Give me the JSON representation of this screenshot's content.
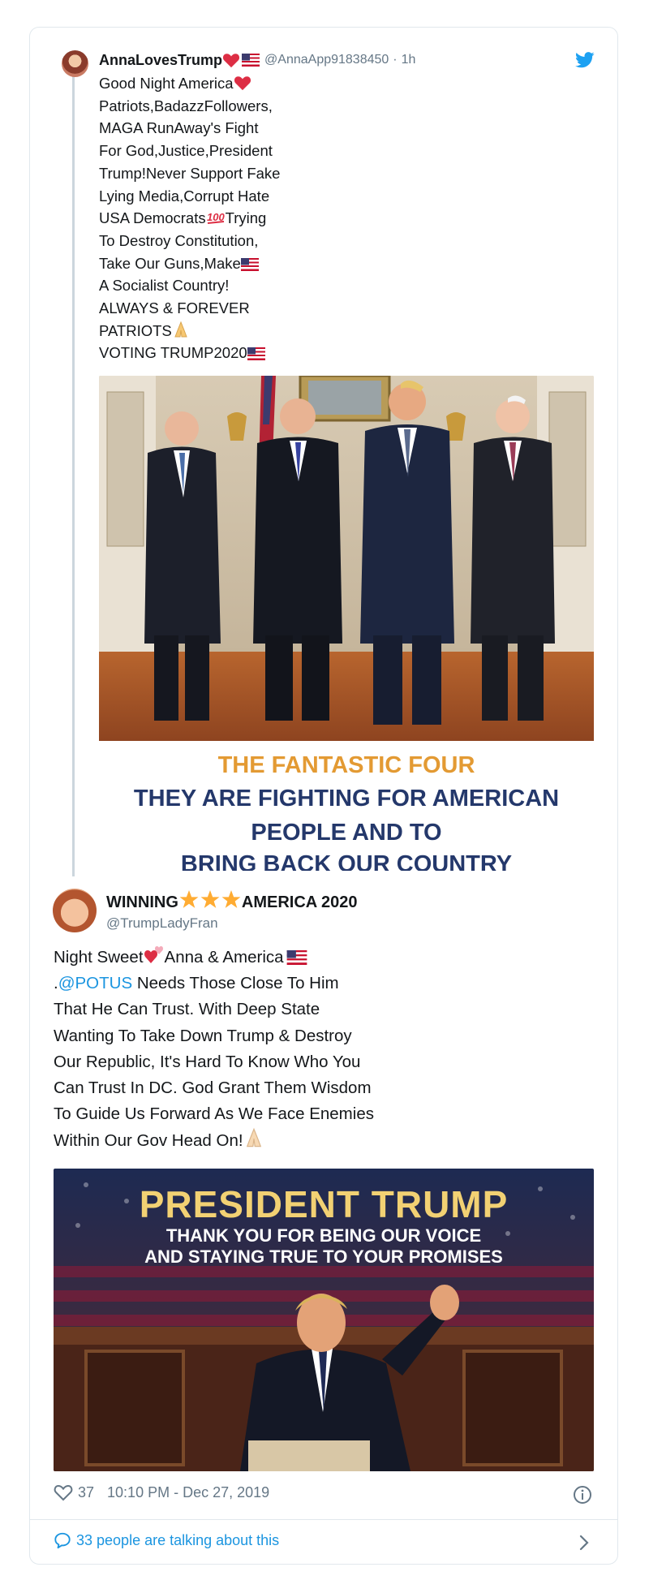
{
  "tweet1": {
    "display_name": "AnnaLovesTrump",
    "name_emojis": [
      "heart-emoji",
      "us-flag-emoji"
    ],
    "handle": "@AnnaApp91838450",
    "separator": "·",
    "time": "1h",
    "lines": [
      {
        "text": "Good Night America",
        "emoji": "heart-emoji"
      },
      {
        "text": "Patriots,BadazzFollowers,"
      },
      {
        "text": "MAGA RunAway's Fight"
      },
      {
        "text": "For God,Justice,President"
      },
      {
        "text": "Trump!Never Support Fake"
      },
      {
        "text": "Lying Media,Corrupt Hate"
      },
      {
        "text": "USA Democrats",
        "emoji": "hundred-emoji",
        "after": "Trying"
      },
      {
        "text": "To Destroy Constitution,"
      },
      {
        "text": "Take Our Guns,Make",
        "emoji": "us-flag-emoji"
      },
      {
        "text": "A Socialist Country!"
      },
      {
        "text": "ALWAYS & FOREVER"
      },
      {
        "text": "PATRIOTS",
        "emoji": "pray-emoji"
      },
      {
        "text": "VOTING TRUMP2020",
        "emoji": "us-flag-emoji"
      }
    ],
    "image": {
      "caption_line1": "THE FANTASTIC FOUR",
      "caption_line2": "THEY ARE FIGHTING FOR AMERICAN",
      "caption_line3": "PEOPLE AND TO",
      "caption_line4": "BRING BACK OUR COUNTRY"
    }
  },
  "tweet2": {
    "display_name_part1": "WINNING",
    "display_name_part2": "AMERICA 2020",
    "name_emojis": [
      "star-emoji",
      "star-emoji",
      "star-emoji"
    ],
    "handle": "@TrumpLadyFran",
    "line1": {
      "pre": "Night Sweet",
      "emoji1": "two-hearts-emoji",
      "post": "Anna & America",
      "emoji2": "us-flag-emoji"
    },
    "line2": {
      "pre": ".",
      "mention": "@POTUS",
      "post": " Needs Those Close To Him"
    },
    "lines": [
      "That He Can Trust. With Deep State",
      "Wanting To Take Down Trump & Destroy",
      "Our Republic, It's Hard To Know Who You",
      "Can Trust In DC. God Grant Them Wisdom",
      "To Guide Us Forward As We Face Enemies"
    ],
    "last_line": {
      "text": "Within Our Gov Head On!",
      "emoji": "pray-emoji"
    },
    "image": {
      "title": "PRESIDENT TRUMP",
      "subtitle1": "THANK YOU FOR BEING OUR VOICE",
      "subtitle2": "AND STAYING TRUE TO YOUR PROMISES"
    },
    "likes": "37",
    "timestamp": "10:10 PM - Dec 27, 2019"
  },
  "footer": {
    "talking": "33 people are talking about this"
  },
  "colors": {
    "link_blue": "#1b95e0",
    "muted": "#657786",
    "border": "#e1e8ed",
    "caption_orange": "#e39a33",
    "caption_navy": "#24386b"
  },
  "icons": [
    "twitter-bird-icon",
    "heart-icon",
    "info-icon",
    "speech-bubble-icon",
    "chevron-right-icon"
  ]
}
